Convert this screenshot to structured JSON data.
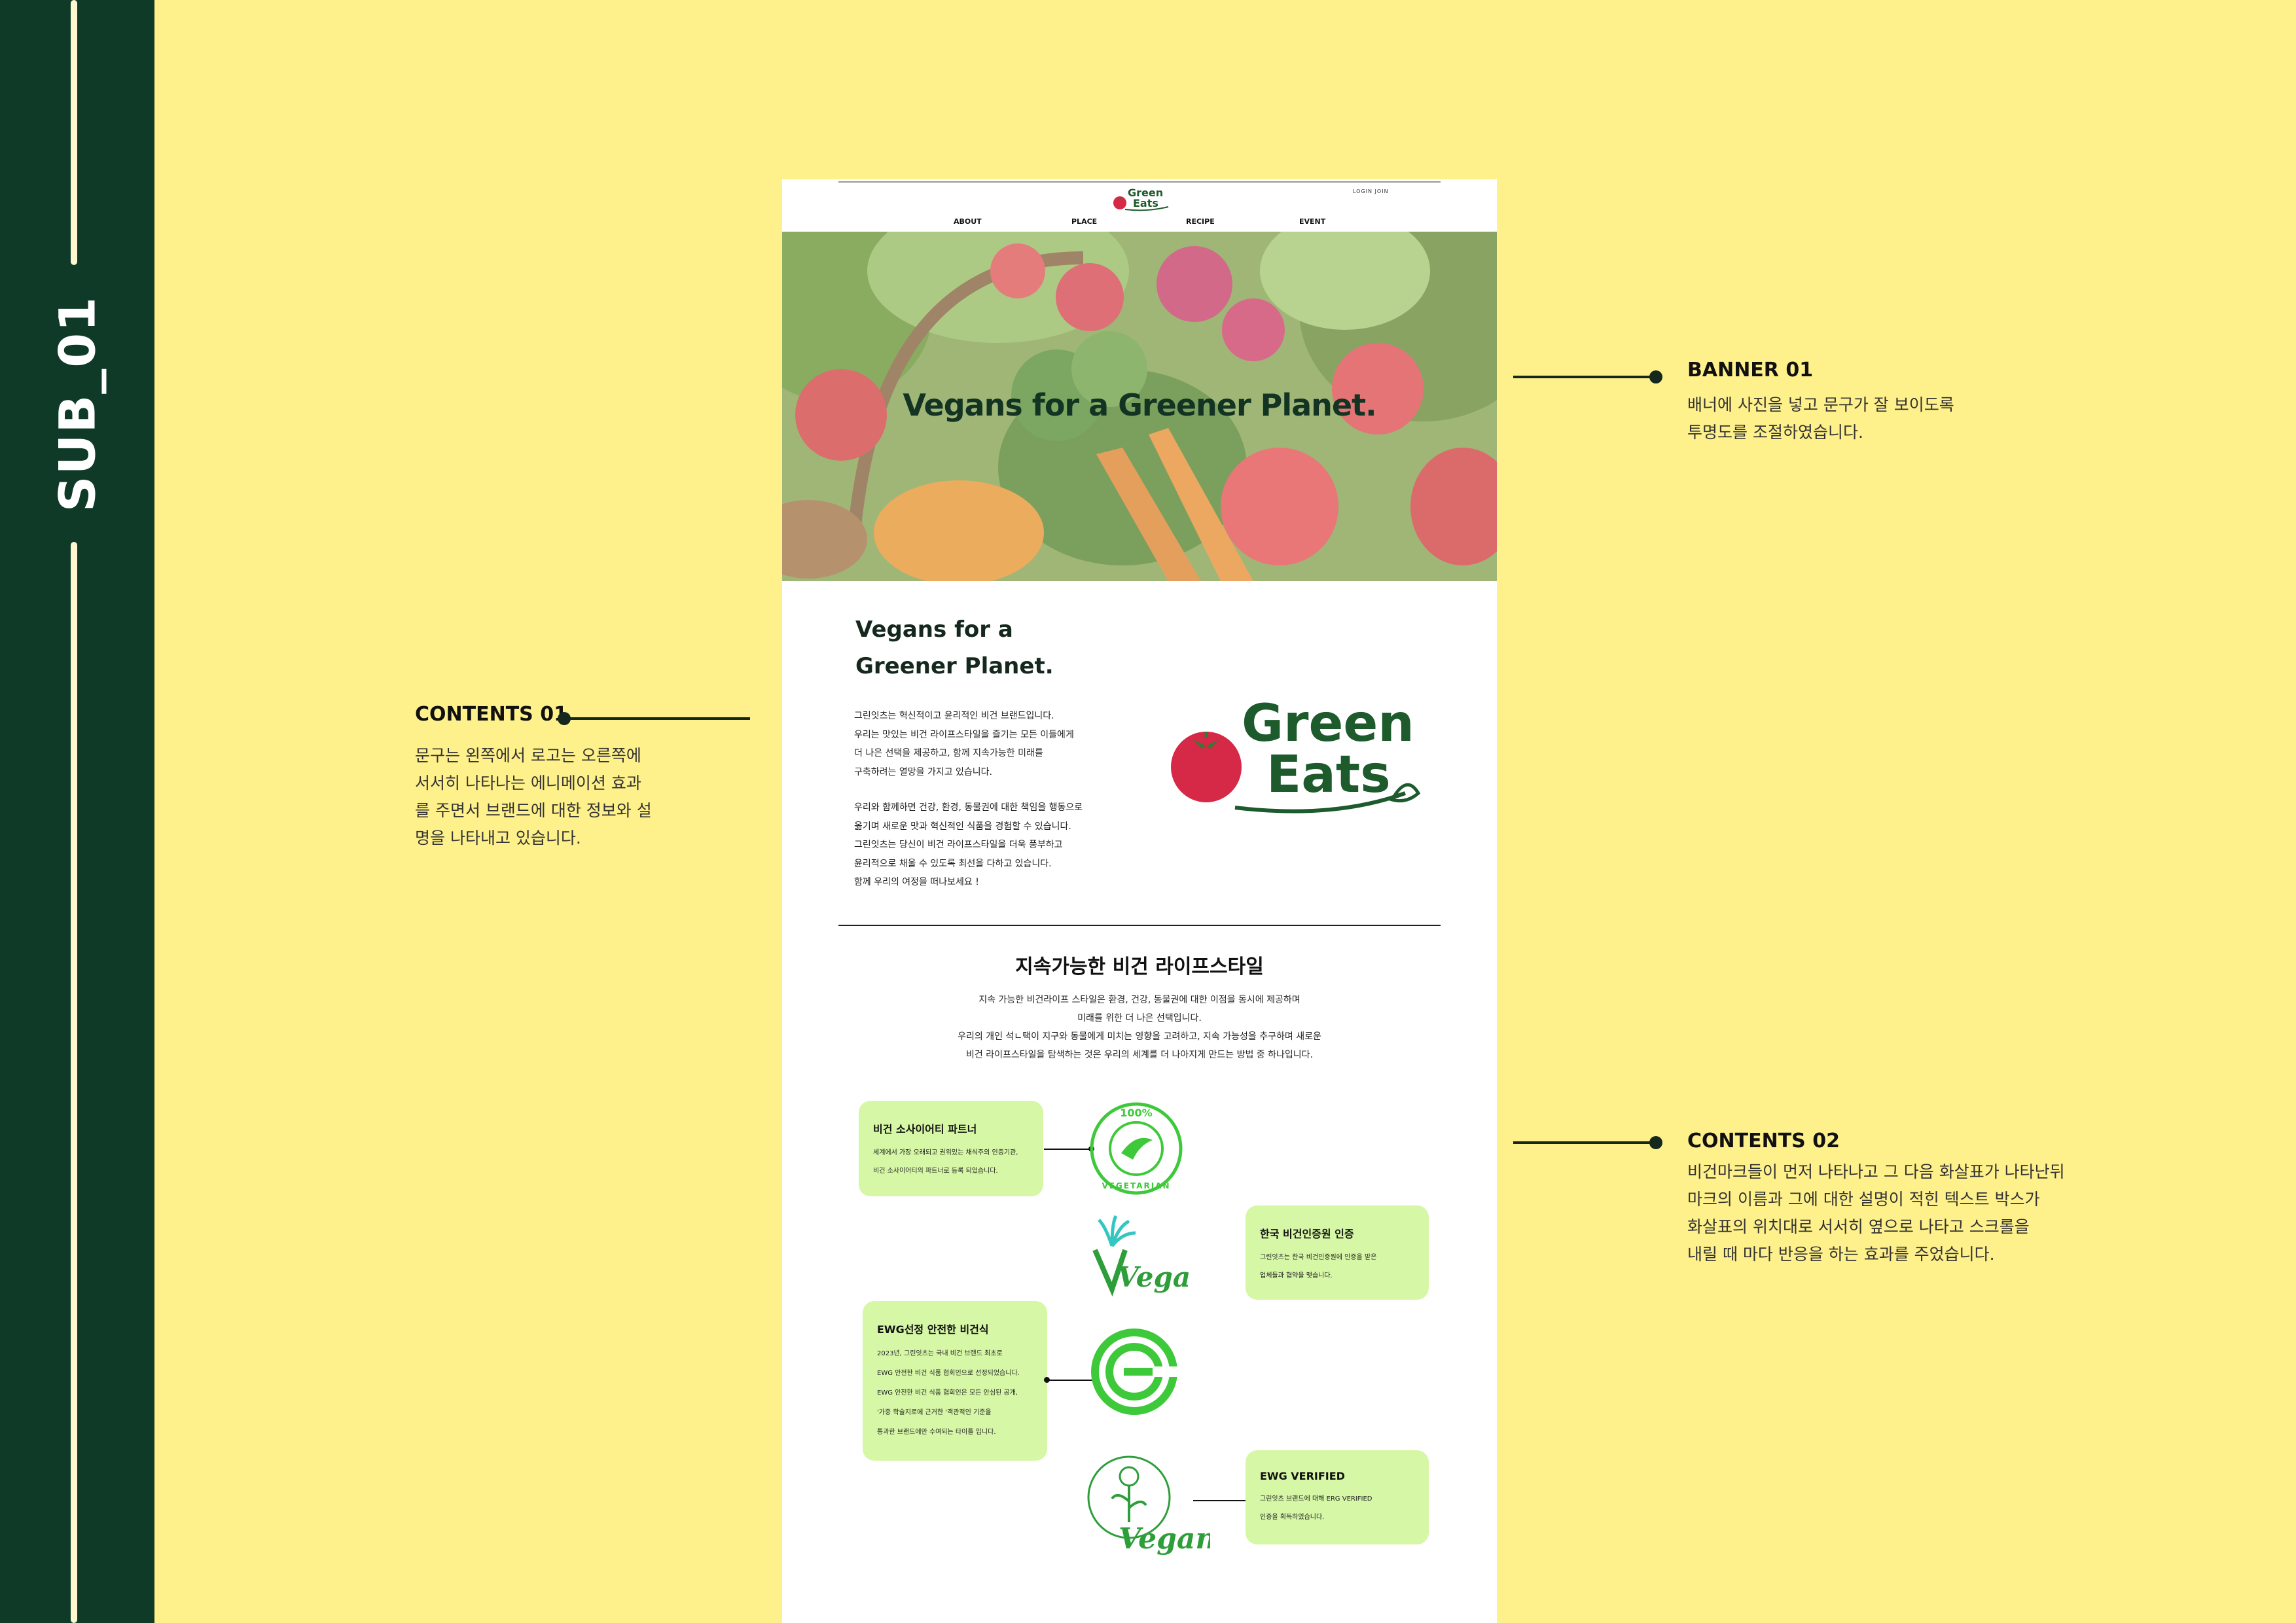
{
  "side_label": "SUB_01",
  "colors": {
    "background": "#fef08a",
    "sidebar": "#0f3a27",
    "brand_green": "#1d5a2c",
    "tomato_red": "#d62847",
    "box_green": "#d6f7a6",
    "mark_green": "#3ec93a"
  },
  "annotations": {
    "banner01": {
      "title": "BANNER 01",
      "lines": [
        "배너에 사진을 넣고 문구가 잘 보이도록",
        "투명도를 조절하였습니다."
      ]
    },
    "contents01": {
      "title": "CONTENTS 01",
      "lines": [
        "문구는 왼쪽에서 로고는 오른쪽에",
        "서서히 나타나는 에니메이션 효과",
        "를 주면서 브랜드에 대한 정보와 설",
        "명을 나타내고 있습니다."
      ]
    },
    "contents02": {
      "title": "CONTENTS 02",
      "lines": [
        "비건마크들이 먼저 나타나고 그 다음 화살표가 나타난뒤",
        "마크의 이름과 그에 대한 설명이 적힌 텍스트 박스가",
        "화살표의 위치대로 서서히 옆으로 나타고 스크롤을",
        "내릴 때 마다 반응을 하는 효과를 주었습니다."
      ]
    }
  },
  "site": {
    "logo_line1": "Green",
    "logo_line2": "Eats",
    "login_join": "LOGIN  JOIN",
    "nav": [
      "ABOUT",
      "PLACE",
      "RECIPE",
      "EVENT"
    ],
    "banner_text": "Vegans for a Greener Planet.",
    "intro": {
      "title_line1": "Vegans for a",
      "title_line2": "Greener Planet.",
      "para1": [
        "그린잇츠는 혁신적이고 윤리적인 비건 브랜드입니다.",
        "우리는 맛있는 비건 라이프스타일을 즐기는 모든 이들에게",
        "더 나은 선택을 제공하고, 함께 지속가능한 미래를",
        "구축하려는 열망을 가지고 있습니다."
      ],
      "para2": [
        "우리와 함께하면 건강, 환경, 동물권에 대한 책임을 행동으로",
        "옮기며 새로운 맛과 혁신적인 식품을 경험할 수 있습니다.",
        "그린잇츠는 당신이 비건 라이프스타일을 더욱 풍부하고",
        "윤리적으로 채울 수 있도록 최선을 다하고 있습니다.",
        "함께 우리의 여정을 떠나보세요 !"
      ]
    },
    "lifestyle": {
      "title": "지속가능한 비건 라이프스타일",
      "para": [
        "지속 가능한 비건라이프 스타일은 환경, 건강, 동물권에 대한 이점을 동시에 제공하며",
        "미래를 위한 더 나은 선택입니다.",
        "우리의 개인 석ㄴ택이 지구와 동물에게 미치는 영향을 고려하고, 지속 가능성을 추구하며 새로운",
        "비건 라이프스타일을 탐색하는 것은 우리의 세계를 더 나아지게 만드는 방법 중 하나입니다."
      ]
    },
    "marks": {
      "m1_text_top": "100%",
      "m1_text_bottom": "VEGETARIAN",
      "m2_word": "Vegan",
      "m4_word": "Vegan"
    },
    "boxes": [
      {
        "title": "비건 소사이어티 파트너",
        "lines": [
          "세계에서 가장 오래되고 권위있는 채식주의 인증기관,",
          "비건 소사이어티의 파트너로 등록 되었습니다."
        ]
      },
      {
        "title": "한국 비건인증원 인증",
        "lines": [
          "그린잇츠는 한국 비건인증원에 인증을 받은",
          "업체들과 협약을 맺습니다."
        ]
      },
      {
        "title": "EWG선정 안전한 비건식",
        "lines": [
          "2023년, 그린잇츠는 국내 비건 브랜드 최초로",
          "EWG 안전한 비건 식품 협회인으로 선정되었습니다.",
          "EWG 안전한 비건 식품 협회인은 모든 안심된 공개,",
          "'가중 학술지로에 근거한 '객관적인 기준을",
          "통과한 브랜드에만 수여되는 타이틀 입니다."
        ]
      },
      {
        "title": "EWG VERIFIED",
        "lines": [
          "그린잇츠 브랜드에 대해 ERG VERIFIED",
          "인증을 획득하였습니다."
        ]
      }
    ]
  }
}
